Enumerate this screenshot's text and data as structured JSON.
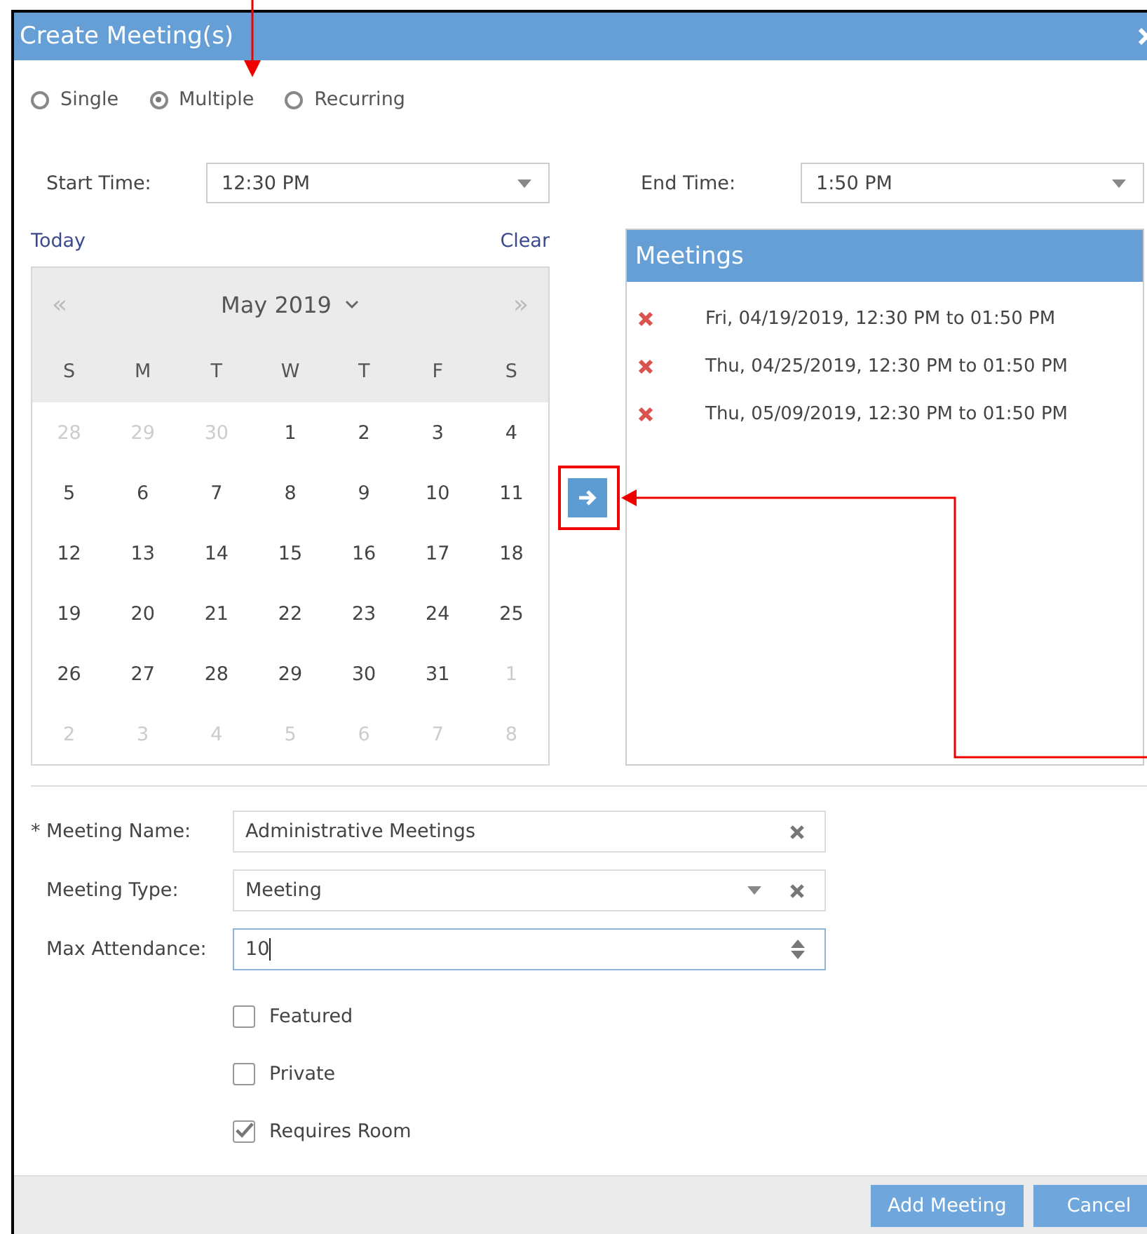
{
  "window": {
    "title": "Create Meeting(s)"
  },
  "modes": [
    {
      "label": "Single",
      "selected": false
    },
    {
      "label": "Multiple",
      "selected": true
    },
    {
      "label": "Recurring",
      "selected": false
    }
  ],
  "start_time": {
    "label": "Start Time:",
    "value": "12:30 PM"
  },
  "end_time": {
    "label": "End Time:",
    "value": "1:50 PM"
  },
  "calendar": {
    "today_link": "Today",
    "clear_link": "Clear",
    "prev": "«",
    "next": "»",
    "month": "May 2019",
    "weekdays": [
      "S",
      "M",
      "T",
      "W",
      "T",
      "F",
      "S"
    ],
    "weeks": [
      [
        {
          "day": "28",
          "other_month": true
        },
        {
          "day": "29",
          "other_month": true
        },
        {
          "day": "30",
          "other_month": true
        },
        {
          "day": "1",
          "other_month": false
        },
        {
          "day": "2",
          "other_month": false
        },
        {
          "day": "3",
          "other_month": false
        },
        {
          "day": "4",
          "other_month": false
        }
      ],
      [
        {
          "day": "5",
          "other_month": false
        },
        {
          "day": "6",
          "other_month": false
        },
        {
          "day": "7",
          "other_month": false
        },
        {
          "day": "8",
          "other_month": false
        },
        {
          "day": "9",
          "other_month": false
        },
        {
          "day": "10",
          "other_month": false
        },
        {
          "day": "11",
          "other_month": false
        }
      ],
      [
        {
          "day": "12",
          "other_month": false
        },
        {
          "day": "13",
          "other_month": false
        },
        {
          "day": "14",
          "other_month": false
        },
        {
          "day": "15",
          "other_month": false
        },
        {
          "day": "16",
          "other_month": false
        },
        {
          "day": "17",
          "other_month": false
        },
        {
          "day": "18",
          "other_month": false
        }
      ],
      [
        {
          "day": "19",
          "other_month": false
        },
        {
          "day": "20",
          "other_month": false
        },
        {
          "day": "21",
          "other_month": false
        },
        {
          "day": "22",
          "other_month": false
        },
        {
          "day": "23",
          "other_month": false
        },
        {
          "day": "24",
          "other_month": false
        },
        {
          "day": "25",
          "other_month": false
        }
      ],
      [
        {
          "day": "26",
          "other_month": false
        },
        {
          "day": "27",
          "other_month": false
        },
        {
          "day": "28",
          "other_month": false
        },
        {
          "day": "29",
          "other_month": false
        },
        {
          "day": "30",
          "other_month": false
        },
        {
          "day": "31",
          "other_month": false
        },
        {
          "day": "1",
          "other_month": true
        }
      ],
      [
        {
          "day": "2",
          "other_month": true
        },
        {
          "day": "3",
          "other_month": true
        },
        {
          "day": "4",
          "other_month": true
        },
        {
          "day": "5",
          "other_month": true
        },
        {
          "day": "6",
          "other_month": true
        },
        {
          "day": "7",
          "other_month": true
        },
        {
          "day": "8",
          "other_month": true
        }
      ]
    ]
  },
  "meetings": {
    "title": "Meetings",
    "items": [
      "Fri, 04/19/2019, 12:30 PM to 01:50 PM",
      "Thu, 04/25/2019, 12:30 PM to 01:50 PM",
      "Thu, 05/09/2019, 12:30 PM to 01:50 PM"
    ]
  },
  "fields": [
    {
      "kind": "text",
      "required_mark": "*",
      "label": "Meeting Name:",
      "value": "Administrative Meetings",
      "focused": false
    },
    {
      "kind": "select",
      "label": "Meeting Type:",
      "value": "Meeting",
      "focused": false
    },
    {
      "kind": "number",
      "label": "Max Attendance:",
      "value": "10",
      "focused": true
    }
  ],
  "checkboxes": [
    {
      "label": "Featured",
      "checked": false
    },
    {
      "label": "Private",
      "checked": false
    },
    {
      "label": "Requires Room",
      "checked": true
    }
  ],
  "buttons": [
    "Add Meeting",
    "Cancel"
  ]
}
